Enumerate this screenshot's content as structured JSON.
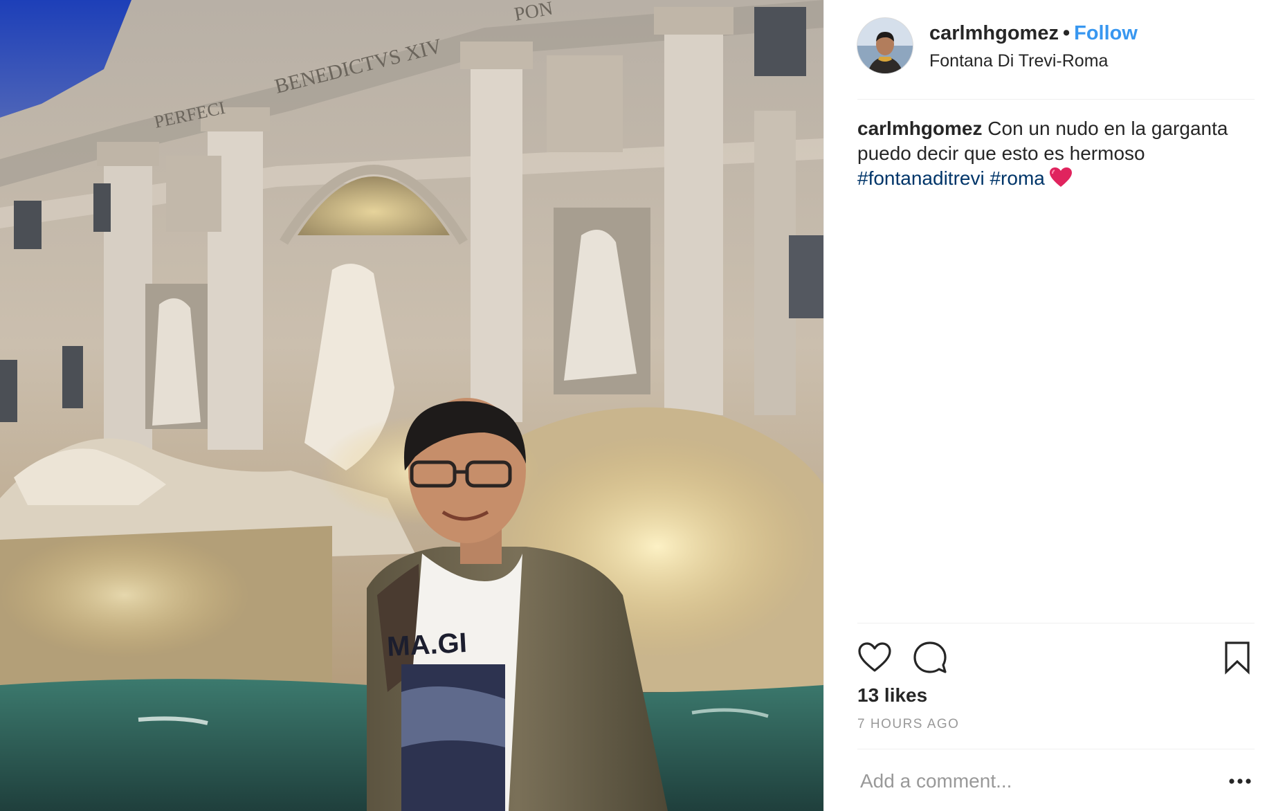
{
  "post": {
    "photo_alt": "",
    "photo_text": {
      "inscription_top": "BENEDICTVS XIV",
      "inscription_left": "PERFECI",
      "inscription_corner": "PON",
      "shirt_text": "MA.GI"
    }
  },
  "header": {
    "username": "carlmhgomez",
    "separator": "•",
    "follow_label": "Follow",
    "location": "Fontana Di Trevi-Roma"
  },
  "caption": {
    "username": "carlmhgomez",
    "text": " Con un nudo en la garganta puedo decir que esto es hermoso ",
    "hashtags": [
      "#fontanaditrevi",
      "#roma"
    ],
    "emoji": "red-heart"
  },
  "actions": {
    "like_icon": "heart-outline-icon",
    "comment_icon": "speech-bubble-icon",
    "save_icon": "bookmark-icon",
    "likes": "13 likes",
    "timestamp": "7 HOURS AGO"
  },
  "comment": {
    "placeholder": "Add a comment...",
    "more_icon": "ellipsis-icon"
  },
  "colors": {
    "link_blue": "#3897f0",
    "hashtag_blue": "#003569",
    "muted_gray": "#999999",
    "divider": "#efefef",
    "heart_red": "#e0245e"
  }
}
